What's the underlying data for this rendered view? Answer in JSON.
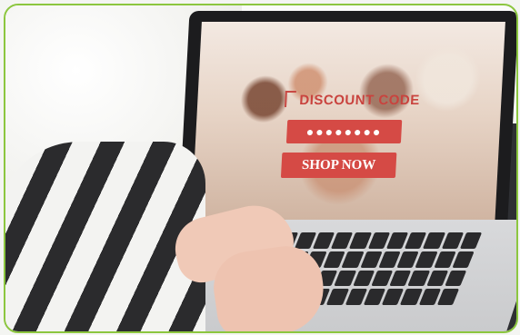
{
  "screen": {
    "promo_label": "DISCOUNT CODE",
    "code_mask": "●●●●●●●●",
    "shop_button_label": "SHOP NOW"
  },
  "colors": {
    "frame_border": "#8cc63f",
    "promo_red": "#d54a45"
  }
}
